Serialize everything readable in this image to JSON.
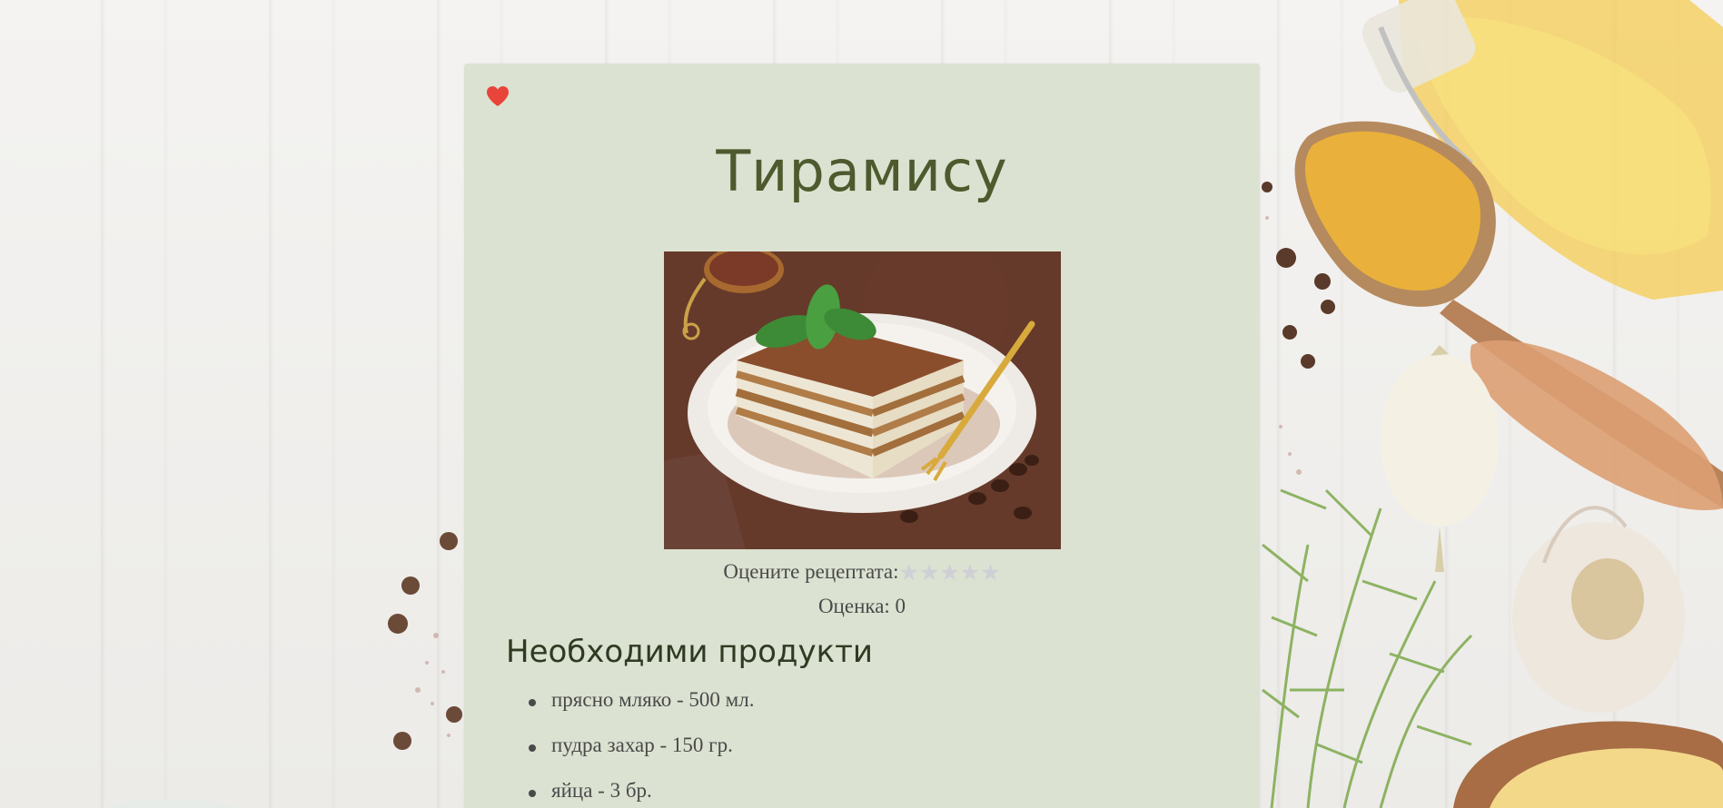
{
  "recipe": {
    "title": "Тирамису",
    "rate_label": "Оцените рецептата:",
    "score_label": "Оценка: 0",
    "stars": [
      "★",
      "★",
      "★",
      "★",
      "★"
    ],
    "section_ingredients": "Необходими продукти",
    "ingredients": [
      "прясно мляко - 500 мл.",
      "пудра захар - 150 гр.",
      "яйца - 3 бр."
    ]
  },
  "icons": {
    "favorite": "heart-icon",
    "star": "star-icon"
  },
  "colors": {
    "card_bg": "#dbe2d1",
    "title": "#4d5a2e",
    "heart": "#e9443a",
    "star_empty": "#cfcfd6",
    "top_bar": "#6a3fa0"
  }
}
